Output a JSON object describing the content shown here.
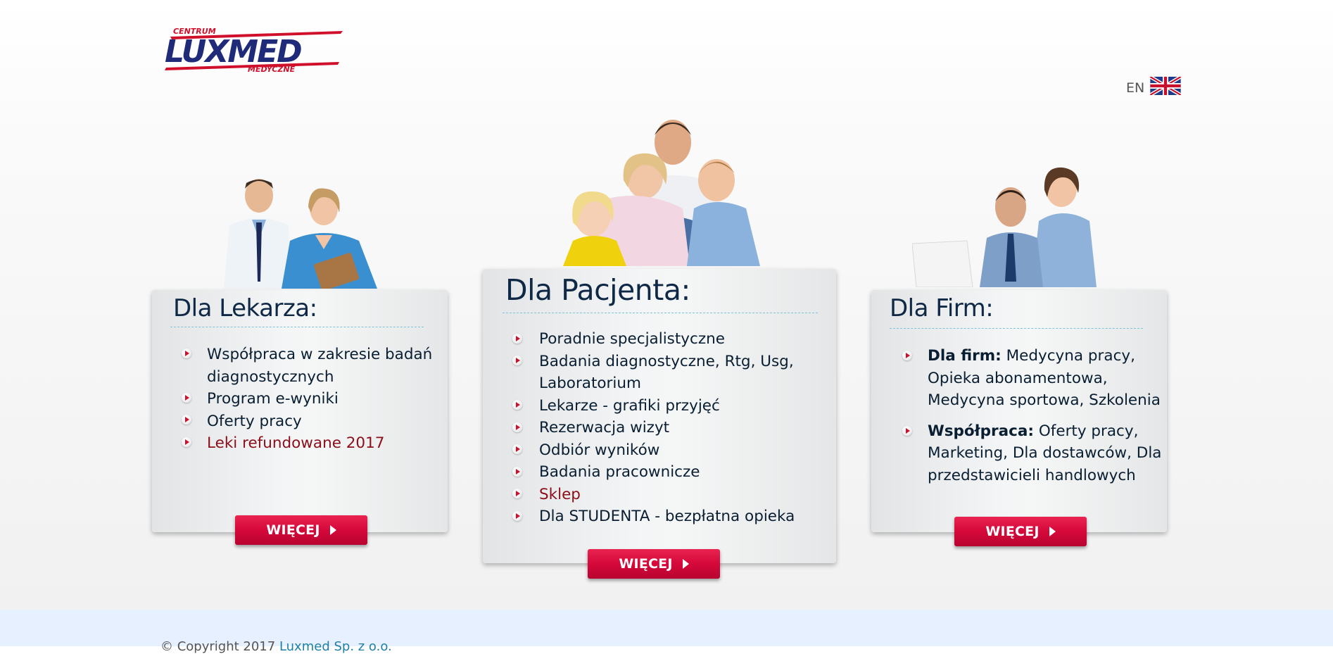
{
  "logo": {
    "top": "CENTRUM",
    "main": "LUXMED",
    "bottom": "MEDYCZNE"
  },
  "language": {
    "label": "EN",
    "icon": "uk-flag-icon"
  },
  "cards": {
    "lekarz": {
      "title": "Dla Lekarza:",
      "items": [
        "Współpraca w zakresie badań diagnostycznych",
        "Program e-wyniki",
        "Oferty pracy",
        "Leki refundowane 2017"
      ],
      "button": "WIĘCEJ"
    },
    "pacjent": {
      "title": "Dla Pacjenta:",
      "items": [
        "Poradnie specjalistyczne",
        "Badania diagnostyczne, Rtg, Usg, Laboratorium",
        "Lekarze - grafiki przyjęć",
        "Rezerwacja wizyt",
        "Odbiór wyników",
        "Badania pracownicze",
        "Sklep",
        "Dla STUDENTA - bezpłatna opieka"
      ],
      "button": "WIĘCEJ"
    },
    "firmy": {
      "title": "Dla Firm:",
      "items": [
        {
          "bold": "Dla firm:",
          "text": " Medycyna pracy, Opieka abonamentowa, Medycyna sportowa, Szkolenia"
        },
        {
          "bold": "Współpraca:",
          "text": " Oferty pracy, Marketing, Dla dostawców, Dla przedstawicieli handlowych"
        }
      ],
      "button": "WIĘCEJ"
    }
  },
  "footer": {
    "copyright": "© Copyright 2017 ",
    "company": "Luxmed Sp. z o.o."
  },
  "colors": {
    "accent_red": "#d5083a",
    "title_navy": "#0e2846",
    "link_red": "#8b0e1a",
    "footer_bg": "#e7f0ff"
  }
}
